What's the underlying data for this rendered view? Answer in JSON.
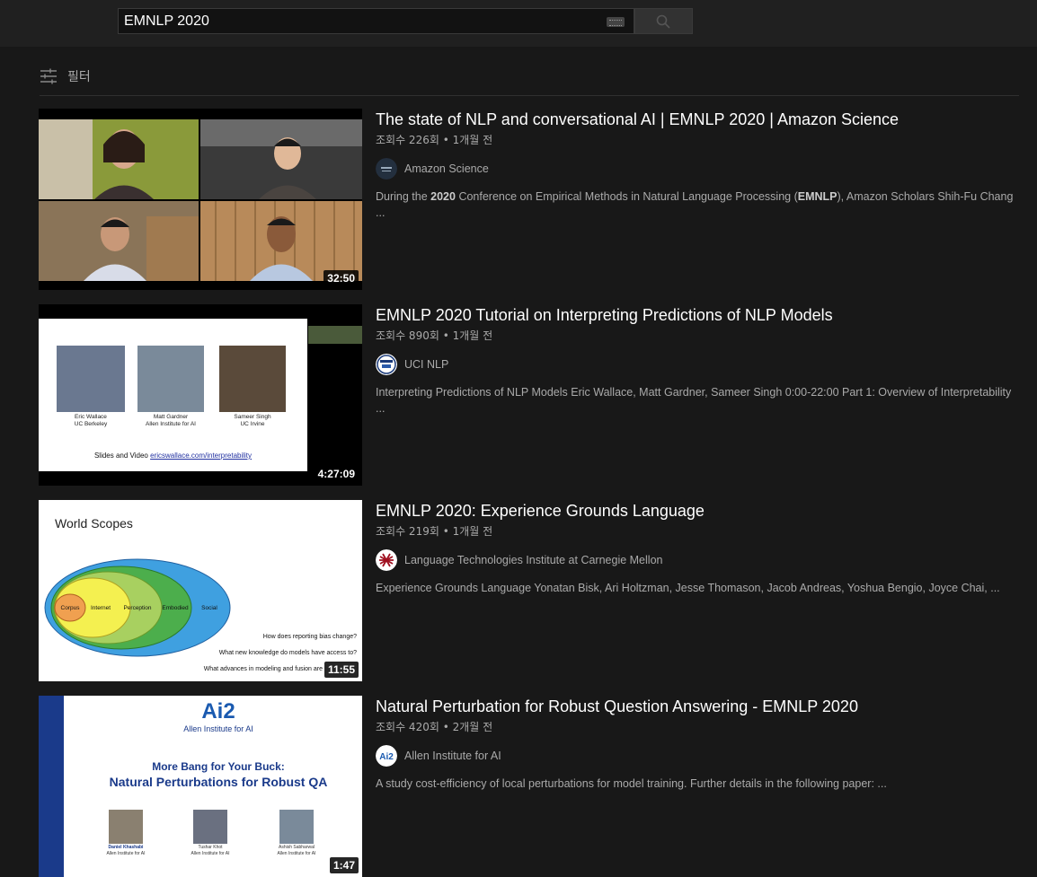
{
  "search": {
    "value": "EMNLP 2020"
  },
  "filter": {
    "label": "필터"
  },
  "videos": [
    {
      "title": "The state of NLP and conversational AI | EMNLP 2020 | Amazon Science",
      "meta": "조회수 226회 • 1개월 전",
      "channel": "Amazon Science",
      "duration": "32:50",
      "description": [
        "During the ",
        "2020",
        " Conference on Empirical Methods in Natural Language Processing (",
        "EMNLP",
        "), Amazon Scholars Shih-Fu Chang ..."
      ]
    },
    {
      "title": "EMNLP 2020 Tutorial on Interpreting Predictions of NLP Models",
      "meta": "조회수 890회 • 1개월 전",
      "channel": "UCI NLP",
      "duration": "4:27:09",
      "description": "Interpreting Predictions of NLP Models Eric Wallace, Matt Gardner, Sameer Singh 0:00-22:00 Part 1: Overview of Interpretability ...",
      "thumb": {
        "people": [
          {
            "name": "Eric Wallace",
            "org": "UC Berkeley"
          },
          {
            "name": "Matt Gardner",
            "org": "Allen Institute for AI"
          },
          {
            "name": "Sameer Singh",
            "org": "UC Irvine"
          }
        ],
        "slides_label": "Slides and Video ",
        "slides_link": "ericswallace.com/interpretability"
      }
    },
    {
      "title": "EMNLP 2020: Experience Grounds Language",
      "meta": "조회수 219회 • 1개월 전",
      "channel": "Language Technologies Institute at Carnegie Mellon",
      "duration": "11:55",
      "description": "Experience Grounds Language Yonatan Bisk, Ari Holtzman, Jesse Thomason, Jacob Andreas, Yoshua Bengio, Joyce Chai, ...",
      "thumb": {
        "heading": "World Scopes",
        "scopes": [
          "Corpus",
          "Internet",
          "Perception",
          "Embodied",
          "Social"
        ],
        "questions": [
          "How does reporting bias change?",
          "What new knowledge do models have access to?",
          "What advances in modeling and fusion are"
        ]
      }
    },
    {
      "title": "Natural Perturbation for Robust Question Answering - EMNLP 2020",
      "meta": "조회수 420회 • 2개월 전",
      "channel": "Allen Institute for AI",
      "duration": "1:47",
      "description": "A study cost-efficiency of local perturbations for model training. Further details in the following paper: ...",
      "thumb": {
        "logo": "Ai2",
        "org": "Allen Institute for AI",
        "line1": "More Bang for Your Buck:",
        "line2": "Natural Perturbations for Robust QA",
        "people": [
          {
            "name": "Daniel Khashabi",
            "org": "Allen Institute for AI"
          },
          {
            "name": "Tushar Khot",
            "org": "Allen Institute for AI"
          },
          {
            "name": "Ashish Sabharwal",
            "org": "Allen Institute for AI"
          }
        ]
      }
    }
  ]
}
